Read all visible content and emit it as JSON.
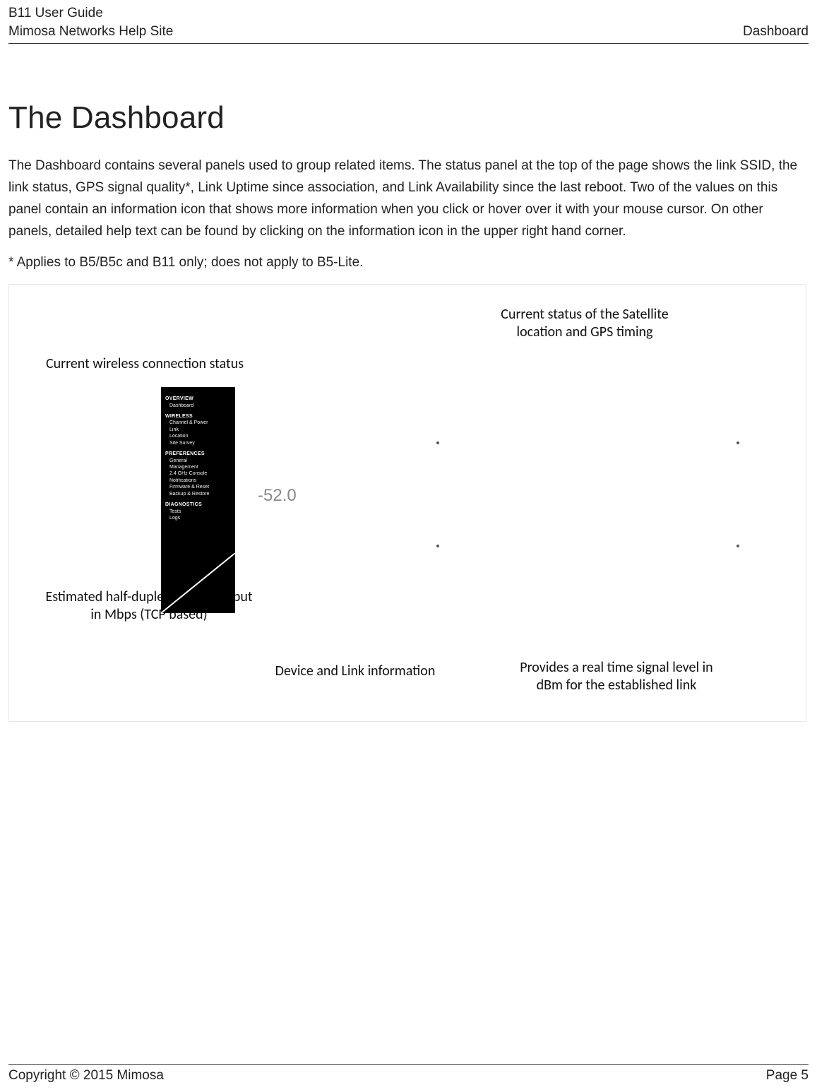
{
  "header": {
    "doc_title": "B11 User Guide",
    "site_name": "Mimosa Networks Help Site",
    "section": "Dashboard"
  },
  "title": "The Dashboard",
  "paragraphs": {
    "p1": "The Dashboard contains several panels used to group related items. The status panel at the top of the page shows the link SSID, the link status, GPS signal quality*, Link Uptime since association, and Link Availability since the last reboot. Two of the values on this panel contain an information icon that shows more information when you click or hover over it with your mouse cursor. On other panels, detailed help text can be found by clicking on the information icon in the upper right hand corner.",
    "p2": "* Applies to B5/B5c and B11 only; does not apply to B5-Lite."
  },
  "callouts": {
    "wireless_status": "Current wireless connection status",
    "satellite_status_l1": "Current status of the Satellite",
    "satellite_status_l2": "location and GPS timing",
    "throughput_l1": "Estimated half-duplex IP throughput",
    "throughput_l2": "in Mbps (TCP based)",
    "device_link": "Device and Link information",
    "signal_l1": "Provides a real time signal level in",
    "signal_l2": "dBm for the established link"
  },
  "sidebar": {
    "sections": [
      {
        "name": "OVERVIEW",
        "items": [
          "Dashboard"
        ]
      },
      {
        "name": "WIRELESS",
        "items": [
          "Channel & Power",
          "Link",
          "Location",
          "Site Survey"
        ]
      },
      {
        "name": "PREFERENCES",
        "items": [
          "General",
          "Management",
          "2.4 GHz Console",
          "Notifications",
          "Firmware & Reset",
          "Backup & Restore"
        ]
      },
      {
        "name": "DIAGNOSTICS",
        "items": [
          "Tests",
          "Logs"
        ]
      }
    ]
  },
  "screenshot_text": {
    "phy_label": "",
    "signal_value": "-52.0"
  },
  "footer": {
    "copyright": "Copyright © 2015 Mimosa",
    "page": "Page 5"
  }
}
